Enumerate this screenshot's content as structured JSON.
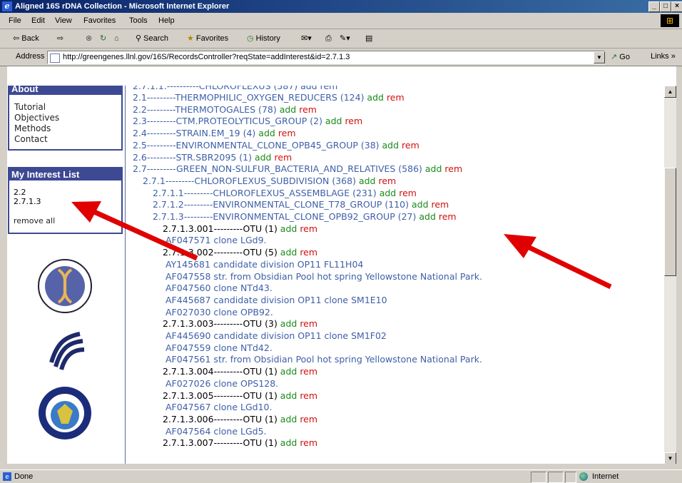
{
  "window": {
    "title": "Aligned 16S rDNA Collection - Microsoft Internet Explorer"
  },
  "menu": [
    "File",
    "Edit",
    "View",
    "Favorites",
    "Tools",
    "Help"
  ],
  "toolbar": {
    "back": "⇦ Back",
    "forward": "⇨",
    "stop": "⊗",
    "refresh": "↻",
    "home": "⌂",
    "search": "Search",
    "favorites": "Favorites",
    "history": "History"
  },
  "address": {
    "label": "Address",
    "url": "http://greengenes.llnl.gov/16S/RecordsController?reqState=addInterest&id=2.7.1.3",
    "go": "Go",
    "links": "Links »"
  },
  "sidebar": {
    "about_title": "About",
    "links": [
      "Tutorial",
      "Objectives",
      "Methods",
      "Contact"
    ],
    "interest_title": "My Interest List",
    "interest_items": [
      "2.2",
      "2.7.1.3"
    ],
    "remove_all": "remove all"
  },
  "tree": {
    "add": "add",
    "rem": "rem",
    "rows": [
      {
        "id": "2.1",
        "label": "---------THERMOPHILIC_OXYGEN_REDUCERS (124)",
        "ctrl": true,
        "type": "group"
      },
      {
        "id": "2.2",
        "label": "---------THERMOTOGALES (78)",
        "ctrl": true,
        "type": "group"
      },
      {
        "id": "2.3",
        "label": "---------CTM.PROTEOLYTICUS_GROUP (2)",
        "ctrl": true,
        "type": "group"
      },
      {
        "id": "2.4",
        "label": "---------STRAIN.EM_19 (4)",
        "ctrl": true,
        "type": "group"
      },
      {
        "id": "2.5",
        "label": "---------ENVIRONMENTAL_CLONE_OPB45_GROUP (38)",
        "ctrl": true,
        "type": "group"
      },
      {
        "id": "2.6",
        "label": "---------STR.SBR2095 (1)",
        "ctrl": true,
        "type": "group"
      },
      {
        "id": "2.7",
        "label": "---------GREEN_NON-SULFUR_BACTERIA_AND_RELATIVES (586)",
        "ctrl": true,
        "type": "group"
      },
      {
        "id": "2.7.1",
        "label": "---------CHLOROFLEXUS_SUBDIVISION (368)",
        "ctrl": true,
        "type": "group"
      },
      {
        "id": "2.7.1.1",
        "label": "---------CHLOROFLEXUS_ASSEMBLAGE (231)",
        "ctrl": true,
        "type": "group"
      },
      {
        "id": "2.7.1.2",
        "label": "---------ENVIRONMENTAL_CLONE_T78_GROUP (110)",
        "ctrl": true,
        "type": "group"
      },
      {
        "id": "2.7.1.3",
        "label": "---------ENVIRONMENTAL_CLONE_OPB92_GROUP (27)",
        "ctrl": true,
        "type": "group"
      },
      {
        "id": "2.7.1.3.001",
        "label": "---------OTU (1)",
        "ctrl": true,
        "type": "otu"
      },
      {
        "id": "",
        "label": "AF047571 clone LGd9.",
        "ctrl": false,
        "type": "seq"
      },
      {
        "id": "2.7.1.3.002",
        "label": "---------OTU (5)",
        "ctrl": true,
        "type": "otu"
      },
      {
        "id": "",
        "label": "AY145681 candidate division OP11 FL11H04",
        "ctrl": false,
        "type": "seq"
      },
      {
        "id": "",
        "label": "AF047558 str. from Obsidian Pool hot spring Yellowstone National Park.",
        "ctrl": false,
        "type": "seq"
      },
      {
        "id": "",
        "label": "AF047560 clone NTd43.",
        "ctrl": false,
        "type": "seq"
      },
      {
        "id": "",
        "label": "AF445687 candidate division OP11 clone SM1E10",
        "ctrl": false,
        "type": "seq"
      },
      {
        "id": "",
        "label": "AF027030 clone OPB92.",
        "ctrl": false,
        "type": "seq"
      },
      {
        "id": "2.7.1.3.003",
        "label": "---------OTU (3)",
        "ctrl": true,
        "type": "otu"
      },
      {
        "id": "",
        "label": "AF445690 candidate division OP11 clone SM1F02",
        "ctrl": false,
        "type": "seq"
      },
      {
        "id": "",
        "label": "AF047559 clone NTd42.",
        "ctrl": false,
        "type": "seq"
      },
      {
        "id": "",
        "label": "AF047561 str. from Obsidian Pool hot spring Yellowstone National Park.",
        "ctrl": false,
        "type": "seq"
      },
      {
        "id": "2.7.1.3.004",
        "label": "---------OTU (1)",
        "ctrl": true,
        "type": "otu"
      },
      {
        "id": "",
        "label": "AF027026 clone OPS128.",
        "ctrl": false,
        "type": "seq"
      },
      {
        "id": "2.7.1.3.005",
        "label": "---------OTU (1)",
        "ctrl": true,
        "type": "otu"
      },
      {
        "id": "",
        "label": "AF047567 clone LGd10.",
        "ctrl": false,
        "type": "seq"
      },
      {
        "id": "2.7.1.3.006",
        "label": "---------OTU (1)",
        "ctrl": true,
        "type": "otu"
      },
      {
        "id": "",
        "label": "AF047564 clone LGd5.",
        "ctrl": false,
        "type": "seq"
      },
      {
        "id": "2.7.1.3.007",
        "label": "---------OTU (1)",
        "ctrl": true,
        "type": "otu"
      }
    ]
  },
  "status": {
    "text": "Done",
    "zone": "Internet"
  },
  "annotation": {
    "arrow_color": "#e00000"
  }
}
